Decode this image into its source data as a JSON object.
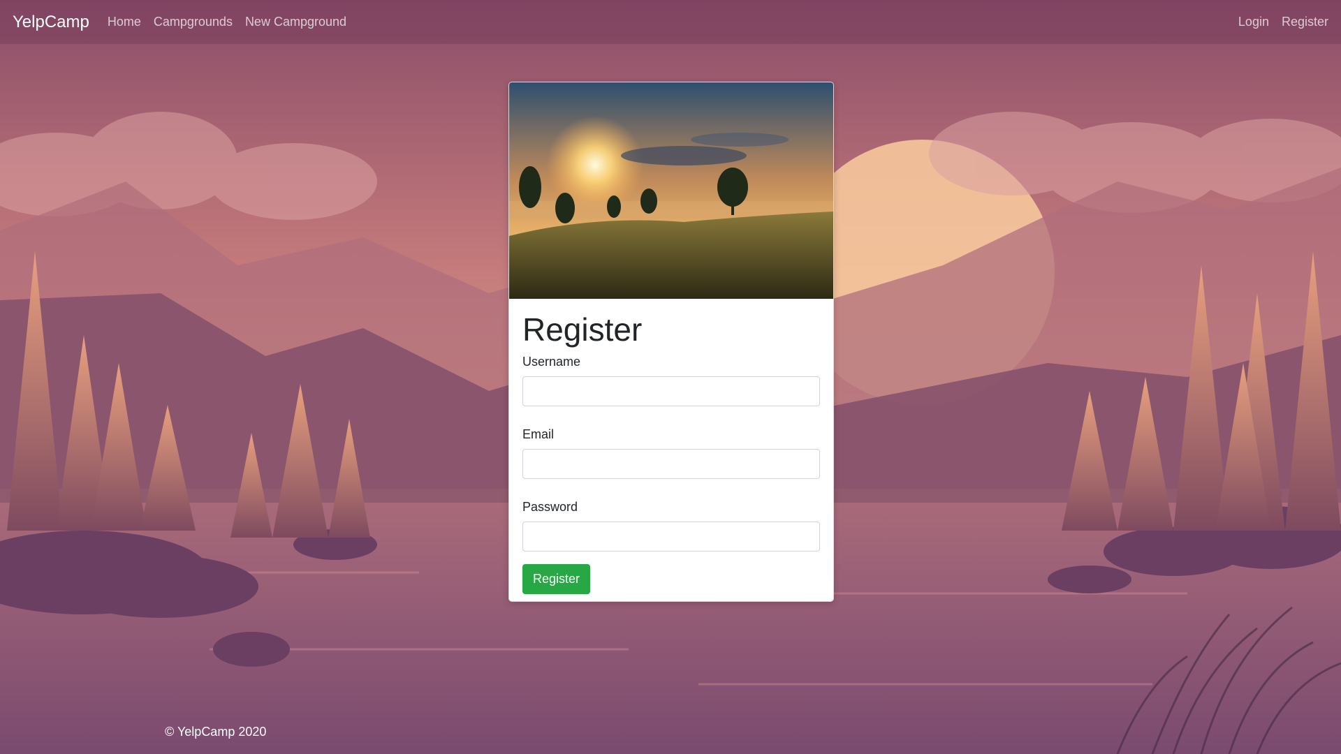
{
  "navbar": {
    "brand": "YelpCamp",
    "links": [
      "Home",
      "Campgrounds",
      "New Campground"
    ],
    "right_links": [
      "Login",
      "Register"
    ]
  },
  "card": {
    "title": "Register",
    "fields": {
      "username": {
        "label": "Username",
        "value": ""
      },
      "email": {
        "label": "Email",
        "value": ""
      },
      "password": {
        "label": "Password",
        "value": ""
      }
    },
    "submit_label": "Register"
  },
  "footer": {
    "text": "© YelpCamp 2020"
  },
  "colors": {
    "primary_button": "#28a745",
    "navbar_bg": "#7a3e5c"
  }
}
